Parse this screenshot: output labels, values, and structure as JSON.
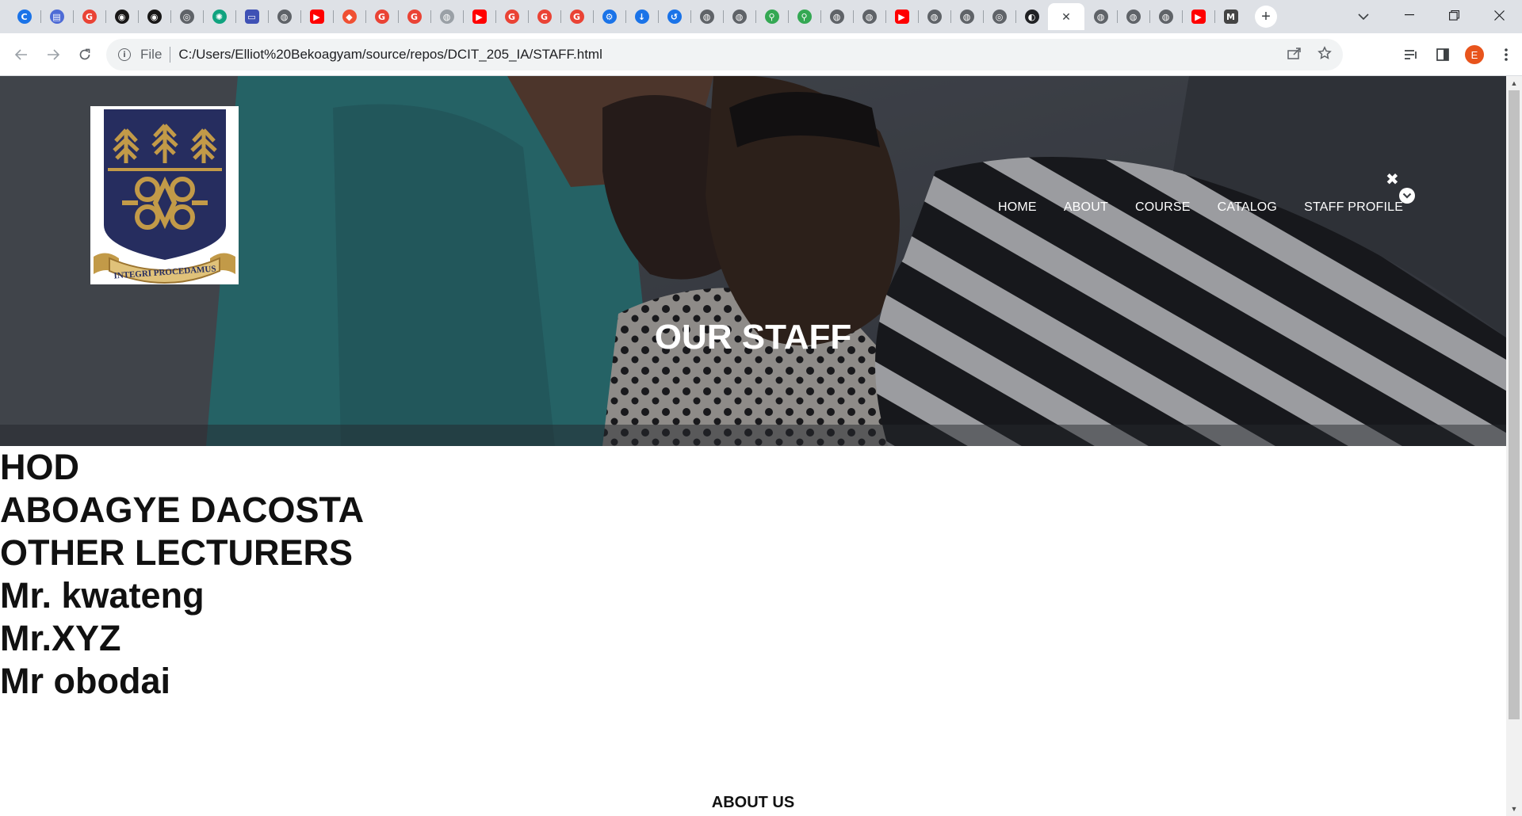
{
  "browser": {
    "tabs": [
      {
        "icon": "cortana-icon",
        "color": "#1a73e8",
        "glyph": "C"
      },
      {
        "icon": "printer-icon",
        "color": "#4e6bd6",
        "glyph": "▤"
      },
      {
        "icon": "google-icon",
        "color": "#ea4335",
        "glyph": "G"
      },
      {
        "icon": "github-icon",
        "color": "#181717",
        "glyph": "◉"
      },
      {
        "icon": "github-icon",
        "color": "#181717",
        "glyph": "◉"
      },
      {
        "icon": "chrome-icon",
        "color": "#5f6368",
        "glyph": "◎"
      },
      {
        "icon": "chatgpt-icon",
        "color": "#10a37f",
        "glyph": "✺"
      },
      {
        "icon": "web-app-icon",
        "color": "#3f51b5",
        "glyph": "▭"
      },
      {
        "icon": "globe-icon",
        "color": "#5f6368",
        "glyph": "◍"
      },
      {
        "icon": "youtube-icon",
        "color": "#ff0000",
        "glyph": "▶"
      },
      {
        "icon": "git-icon",
        "color": "#f05033",
        "glyph": "◆"
      },
      {
        "icon": "google-icon",
        "color": "#ea4335",
        "glyph": "G"
      },
      {
        "icon": "google-icon",
        "color": "#ea4335",
        "glyph": "G"
      },
      {
        "icon": "globe-icon",
        "color": "#9aa0a6",
        "glyph": "◍"
      },
      {
        "icon": "youtube-icon",
        "color": "#ff0000",
        "glyph": "▶"
      },
      {
        "icon": "google-icon",
        "color": "#ea4335",
        "glyph": "G"
      },
      {
        "icon": "google-icon",
        "color": "#ea4335",
        "glyph": "G"
      },
      {
        "icon": "google-icon",
        "color": "#ea4335",
        "glyph": "G"
      },
      {
        "icon": "settings-icon",
        "color": "#1a73e8",
        "glyph": "⚙"
      },
      {
        "icon": "download-icon",
        "color": "#1a73e8",
        "glyph": "↓"
      },
      {
        "icon": "history-icon",
        "color": "#1a73e8",
        "glyph": "↺"
      },
      {
        "icon": "globe-icon",
        "color": "#5f6368",
        "glyph": "◍"
      },
      {
        "icon": "globe-icon",
        "color": "#5f6368",
        "glyph": "◍"
      },
      {
        "icon": "maps-icon",
        "color": "#34a853",
        "glyph": "⚲"
      },
      {
        "icon": "maps-icon",
        "color": "#34a853",
        "glyph": "⚲"
      },
      {
        "icon": "globe-icon",
        "color": "#5f6368",
        "glyph": "◍"
      },
      {
        "icon": "globe-icon",
        "color": "#5f6368",
        "glyph": "◍"
      },
      {
        "icon": "youtube-icon",
        "color": "#ff0000",
        "glyph": "▶"
      },
      {
        "icon": "globe-icon",
        "color": "#5f6368",
        "glyph": "◍"
      },
      {
        "icon": "globe-icon",
        "color": "#5f6368",
        "glyph": "◍"
      },
      {
        "icon": "chrome-icon",
        "color": "#5f6368",
        "glyph": "◎"
      },
      {
        "icon": "app-icon",
        "color": "#202124",
        "glyph": "◐"
      }
    ],
    "tabs_after_active": [
      {
        "icon": "globe-icon",
        "color": "#5f6368",
        "glyph": "◍"
      },
      {
        "icon": "globe-icon",
        "color": "#5f6368",
        "glyph": "◍"
      },
      {
        "icon": "globe-icon",
        "color": "#5f6368",
        "glyph": "◍"
      },
      {
        "icon": "youtube-icon",
        "color": "#ff0000",
        "glyph": "▶"
      },
      {
        "icon": "markdown-icon",
        "color": "#444",
        "glyph": "M"
      }
    ],
    "active_tab_close": "✕",
    "new_tab": "+",
    "url_scheme_label": "File",
    "url": "C:/Users/Elliot%20Bekoagyam/source/repos/DCIT_205_IA/STAFF.html",
    "profile_initial": "E"
  },
  "page": {
    "nav": [
      "HOME",
      "ABOUT",
      "COURSE",
      "CATALOG",
      "STAFF PROFILE"
    ],
    "logo_motto": "INTEGRI PROCEDAMUS",
    "hero_title": "OUR STAFF",
    "staff_lines": [
      "HOD",
      "ABOAGYE DACOSTA",
      "OTHER LECTURERS",
      "Mr. kwateng",
      "Mr.XYZ",
      "Mr obodai"
    ],
    "about_heading": "ABOUT US"
  },
  "colors": {
    "crest_blue": "#262d5f",
    "crest_gold": "#c29a48"
  }
}
